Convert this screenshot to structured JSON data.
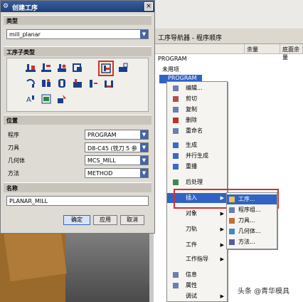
{
  "dialog": {
    "title": "创建工序",
    "type_section": "类型",
    "type_value": "mill_planar",
    "subtype_section": "工序子类型",
    "location_section": "位置",
    "location": [
      {
        "label": "程序",
        "value": "PROGRAM"
      },
      {
        "label": "刀具",
        "value": "D8-C45 (铣刀 5 参"
      },
      {
        "label": "几何体",
        "value": "MCS_MILL"
      },
      {
        "label": "方法",
        "value": "METHOD"
      }
    ],
    "name_section": "名称",
    "name_value": "PLANAR_MILL",
    "ok": "确定",
    "apply": "应用",
    "cancel": "取消"
  },
  "navigator": {
    "title": "工序导航器 - 程序顺序",
    "col2": "余量",
    "col3": "底面余量",
    "rows": [
      "PROGRAM",
      "未用项",
      "PROGRAM"
    ]
  },
  "context_menu": {
    "items": [
      "编辑...",
      "剪切",
      "复制",
      "删除",
      "重命名",
      "生成",
      "并行生成",
      "重播",
      "后处理",
      "插入",
      "对象",
      "刀轨",
      "工件",
      "工作指导",
      "信息",
      "属性",
      "调试"
    ]
  },
  "insert_submenu": {
    "items": [
      "工序...",
      "程序组...",
      "刀具...",
      "几何体...",
      "方法..."
    ]
  },
  "watermark": "头条 @青华模具",
  "colors": {
    "highlight": "#d03030",
    "selection": "#3163c5",
    "title_bar": "#2a4e8c"
  }
}
